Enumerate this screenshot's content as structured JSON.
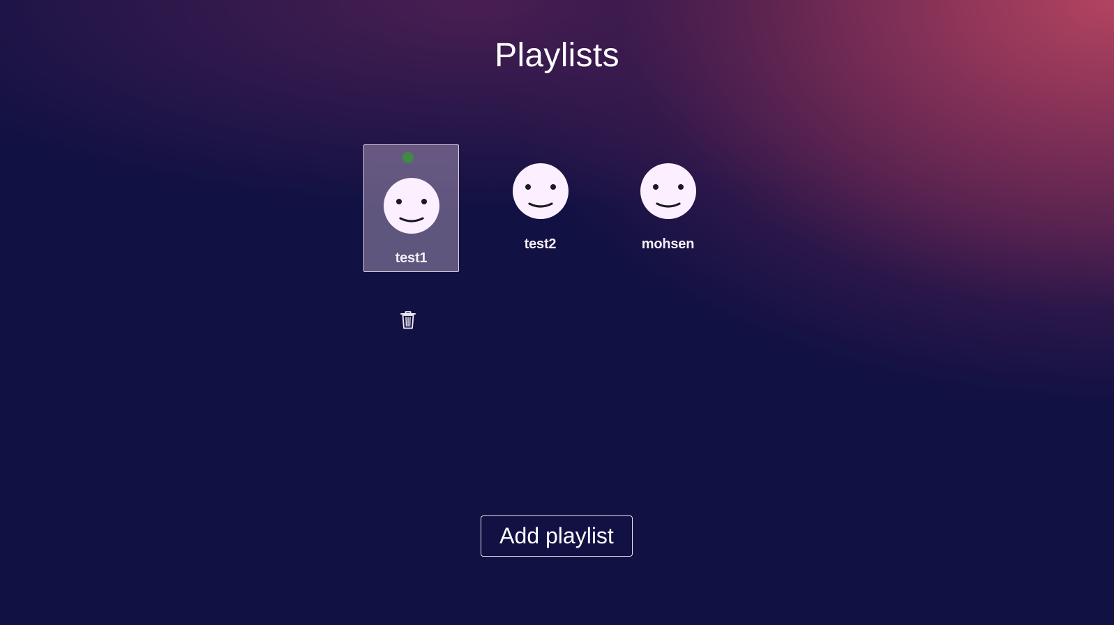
{
  "page": {
    "title": "Playlists"
  },
  "playlists": [
    {
      "label": "test1",
      "selected": true,
      "status": "active"
    },
    {
      "label": "test2",
      "selected": false
    },
    {
      "label": "mohsen",
      "selected": false
    }
  ],
  "actions": {
    "delete_icon": "trash-icon",
    "add_label": "Add playlist"
  },
  "colors": {
    "background": "#121143",
    "accent_glow": "#b24460",
    "status_dot": "#3f8a45",
    "avatar_face": "#fcefff"
  },
  "icons": {
    "avatar": "smiley-face-icon",
    "status": "status-dot-icon"
  }
}
